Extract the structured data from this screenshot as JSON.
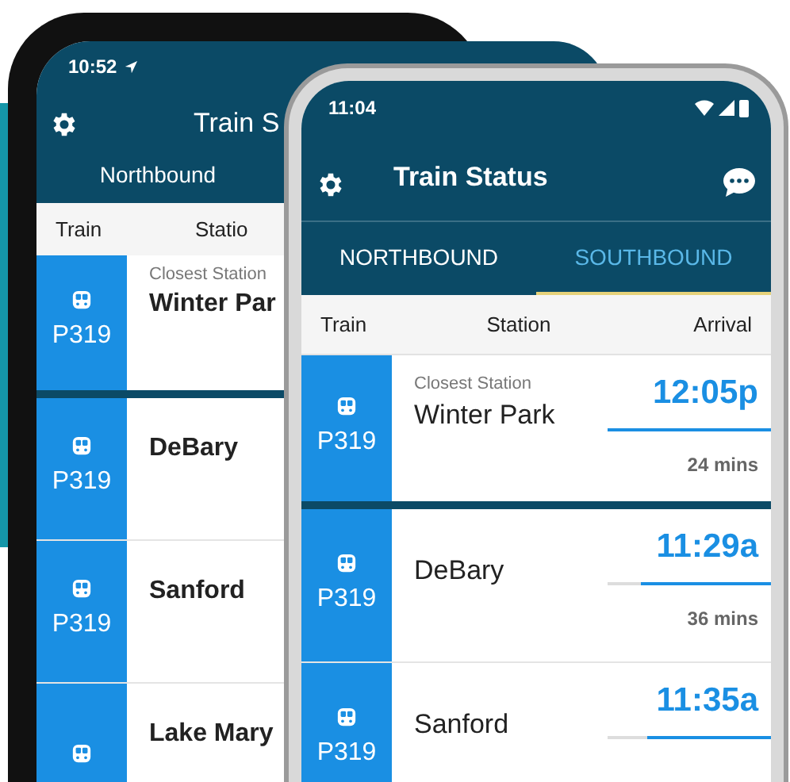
{
  "phones": [
    {
      "kind": "ios",
      "time": "10:52",
      "title": "Train S",
      "tabs": [
        {
          "label": "Northbound",
          "selected": true
        }
      ],
      "columns": [
        "Train",
        "Statio"
      ],
      "rows": [
        {
          "train": "P319",
          "note": "Closest Station",
          "station": "Winter Par"
        },
        {
          "train": "P319",
          "station": "DeBary"
        },
        {
          "train": "P319",
          "station": "Sanford"
        },
        {
          "station": "Lake Mary"
        }
      ]
    },
    {
      "kind": "android",
      "time": "11:04",
      "title": "Train Status",
      "tabs": [
        {
          "label": "NORTHBOUND",
          "selected": false
        },
        {
          "label": "SOUTHBOUND",
          "selected": true
        }
      ],
      "columns": [
        "Train",
        "Station",
        "Arrival"
      ],
      "rows": [
        {
          "train": "P319",
          "note": "Closest Station",
          "station": "Winter Park",
          "arrival": "12:05p",
          "level": 1,
          "eta": "24 mins"
        },
        {
          "train": "P319",
          "station": "DeBary",
          "arrival": "11:29a",
          "level": 0.8,
          "eta": "36 mins"
        },
        {
          "train": "P319",
          "station": "Sanford",
          "arrival": "11:35a",
          "level": 0.76
        }
      ]
    }
  ]
}
